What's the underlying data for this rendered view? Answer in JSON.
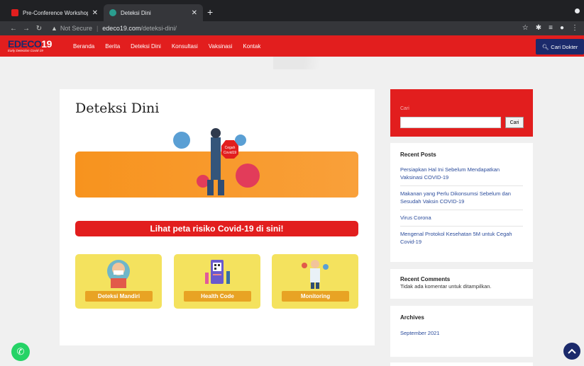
{
  "browser": {
    "tabs": [
      {
        "title": "Pre-Conference Workshop Pro",
        "active": false,
        "favicon_color": "#e21e1e"
      },
      {
        "title": "Deteksi Dini",
        "active": true,
        "favicon_color": "#2a9d8f"
      }
    ],
    "address": {
      "not_secure_label": "Not Secure",
      "host": "edeco19.com",
      "path": "/deteksi-dini/"
    }
  },
  "site": {
    "logo_text_main": "EDECO",
    "logo_text_num": "19",
    "logo_tagline": "Early Detection Covid-19",
    "menu": [
      "Beranda",
      "Berita",
      "Deteksi Dini",
      "Konsultasi",
      "Vaksinasi",
      "Kontak"
    ],
    "cari_dokter": "Cari Dokter",
    "brand_red": "#e21e1e",
    "brand_navy": "#1b2a6b"
  },
  "main": {
    "title": "Deteksi Dini",
    "hero_sign": "Cegah Covid19",
    "risk_button": "Lihat peta risiko Covid-19 di sini!",
    "cards": [
      "Deteksi Mandiri",
      "Health Code",
      "Monitoring"
    ]
  },
  "sidebar": {
    "search_label": "Cari",
    "search_button": "Cari",
    "recent_posts_title": "Recent Posts",
    "recent_posts": [
      "Persiapkan Hal Ini Sebelum Mendapatkan Vaksinasi COVID-19",
      "Makanan yang Perlu Dikonsumsi Sebelum dan Sesudah Vaksin COVID-19",
      "Virus Corona",
      "Mengenal Protokol Kesehatan 5M untuk Cegah Covid-19"
    ],
    "recent_comments_title": "Recent Comments",
    "recent_comments_empty": "Tidak ada komentar untuk ditampilkan.",
    "archives_title": "Archives",
    "archives": [
      "September 2021"
    ]
  }
}
